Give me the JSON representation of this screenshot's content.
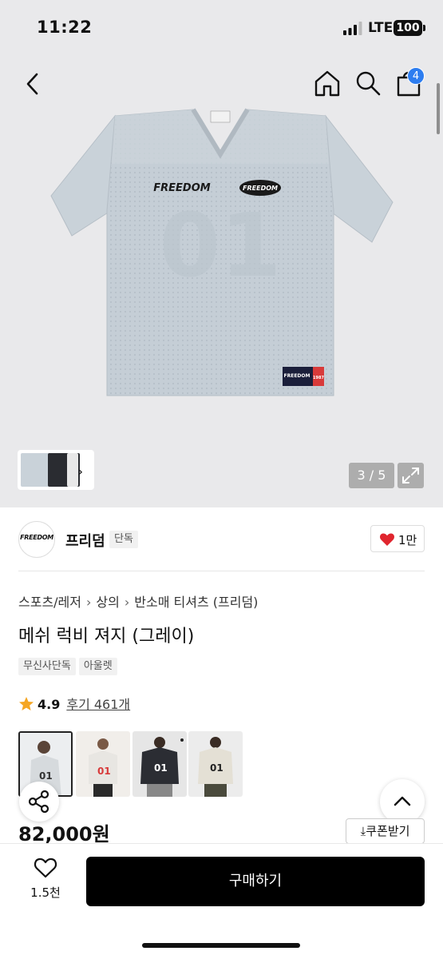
{
  "status": {
    "time": "11:22",
    "network": "LTE",
    "battery": "100"
  },
  "header": {
    "cart_count": "4"
  },
  "gallery": {
    "counter": "3 / 5"
  },
  "product_art": {
    "chest_text": "FREEDOM",
    "badge_text": "FREEDOM",
    "hem_label": "FREEDOM",
    "hem_year": "1987"
  },
  "brand": {
    "logo_text": "FREEDOM",
    "name": "프리덤",
    "tag": "단독",
    "likes": "1만"
  },
  "breadcrumb": {
    "items": [
      "스포츠/레저",
      "상의",
      "반소매 티셔츠 (프리덤)"
    ]
  },
  "product": {
    "title": "메쉬 럭비 져지 (그레이)",
    "tags": [
      "무신사단독",
      "아울렛"
    ],
    "rating": "4.9",
    "reviews": "후기 461개",
    "price": "82,000원",
    "coupon_label": "쿠폰받기"
  },
  "variants": [
    {
      "label": "01",
      "color": "#d6dadd"
    },
    {
      "label": "01",
      "color": "#e8e6e2"
    },
    {
      "label": "01",
      "color": "#2b2d33"
    },
    {
      "label": "01",
      "color": "#e4e0d5"
    }
  ],
  "bottom_bar": {
    "wish_count": "1.5천",
    "buy_label": "구매하기"
  },
  "colors": {
    "heart": "#e0252e",
    "badge": "#2d7df0",
    "star": "#f5a623",
    "buy_bg": "#000000"
  }
}
